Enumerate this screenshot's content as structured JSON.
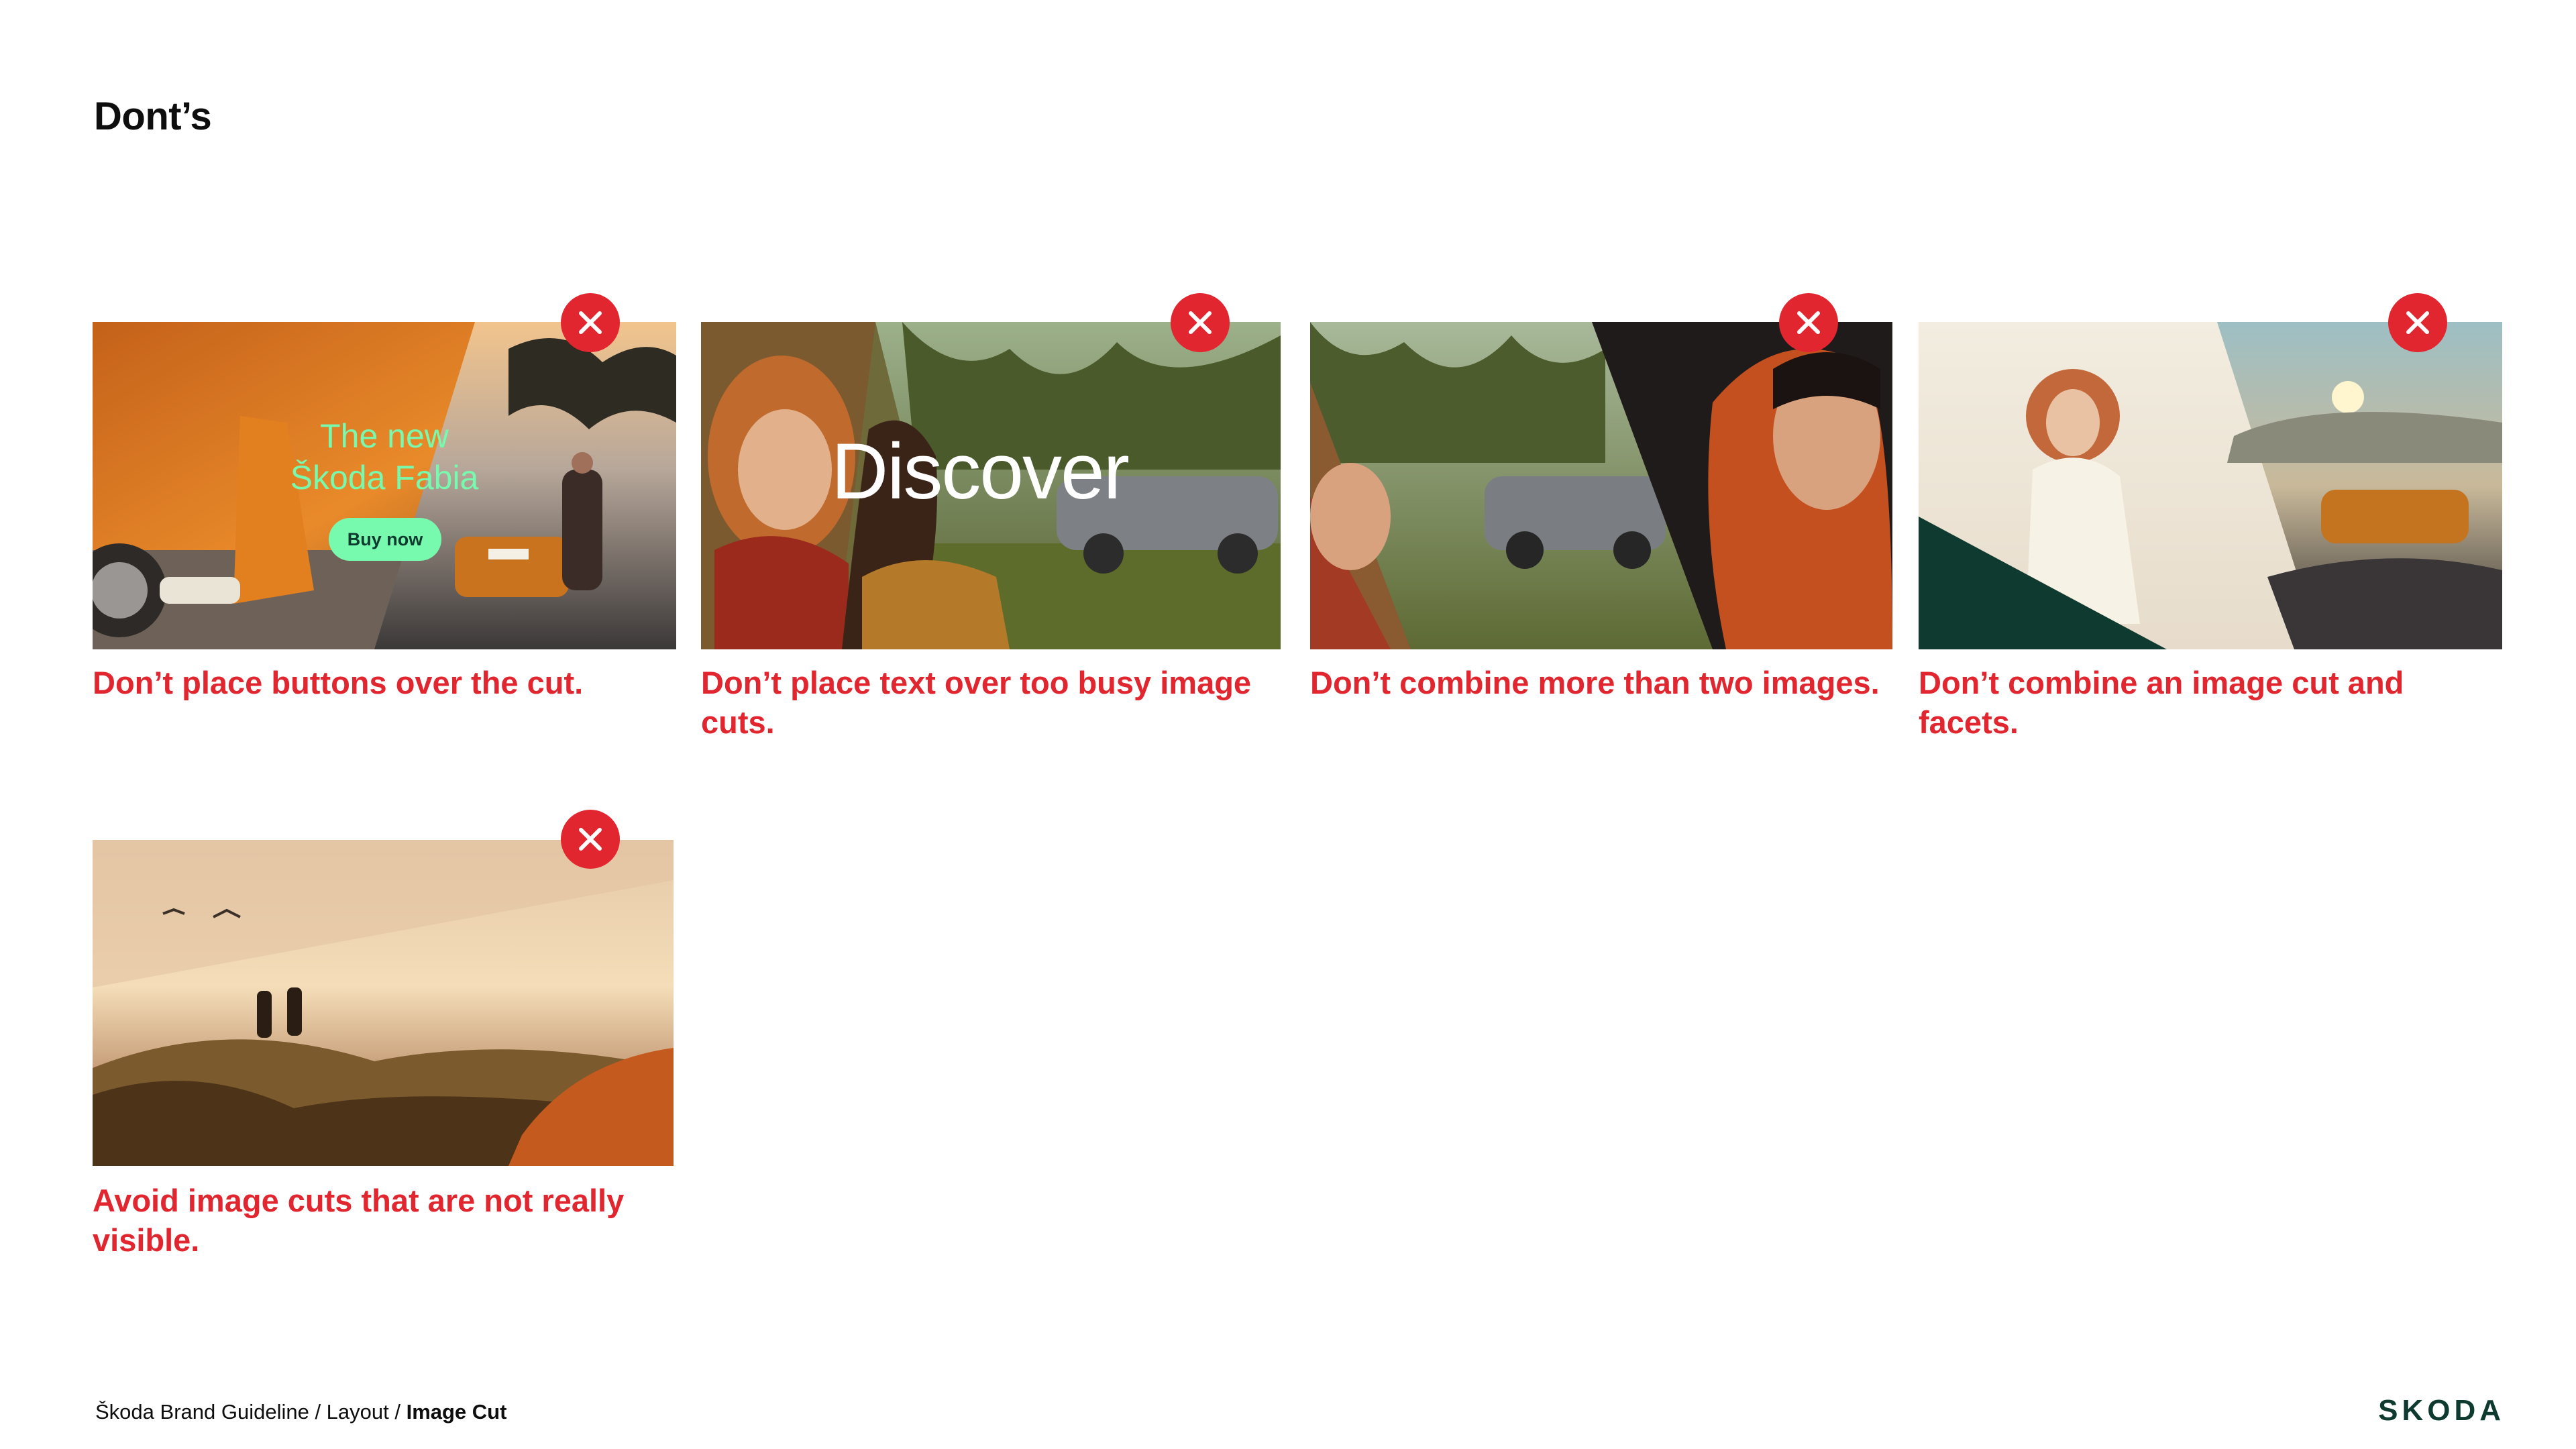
{
  "page": {
    "title": "Dont’s"
  },
  "cards": [
    {
      "caption": "Don’t place buttons over the cut.",
      "overlay": {
        "line1": "The new",
        "line2": "Škoda Fabia",
        "button": "Buy now"
      }
    },
    {
      "caption": "Don’t place text over too busy image cuts.",
      "overlay": {
        "headline": "Discover"
      }
    },
    {
      "caption": "Don’t combine more than two images."
    },
    {
      "caption": "Don’t combine an image cut and facets."
    },
    {
      "caption": "Avoid image cuts that are not really visible."
    }
  ],
  "footer": {
    "breadcrumb_prefix": "Škoda Brand Guideline / Layout / ",
    "breadcrumb_current": "Image Cut",
    "logo": "SKODA"
  },
  "colors": {
    "warning_red": "#e1262f",
    "skoda_green": "#78faae",
    "skoda_dark_green": "#0e3a2f"
  },
  "icons": {
    "badge": "close-icon"
  }
}
